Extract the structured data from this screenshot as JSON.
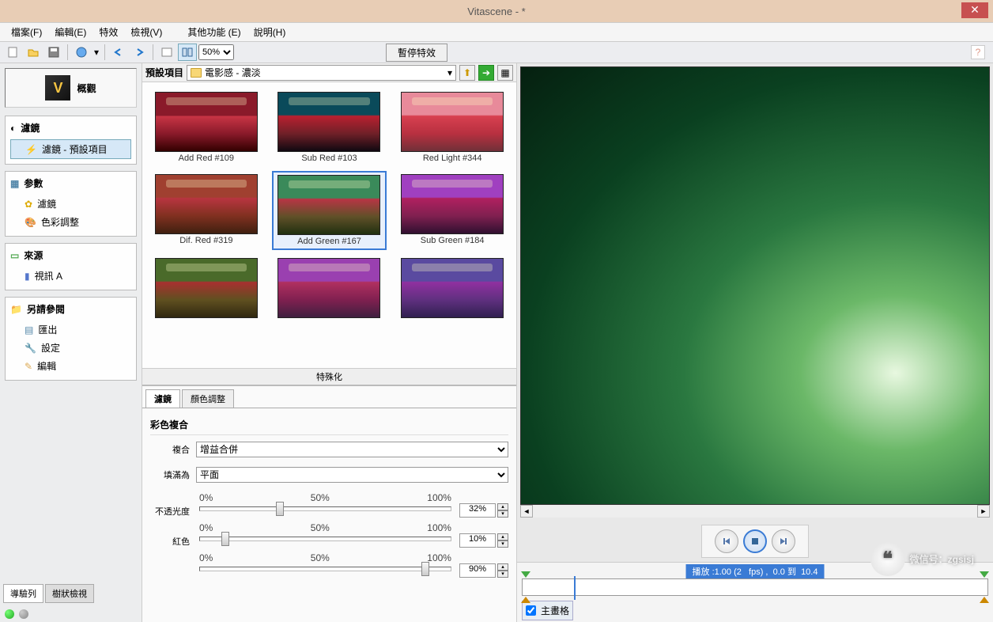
{
  "window": {
    "title": "Vitascene - *",
    "close": "✕"
  },
  "menu": {
    "file": "檔案(F)",
    "edit": "編輯(E)",
    "fx": "特效",
    "view": "檢視(V)",
    "other": "其他功能 (E)",
    "help": "說明(H)"
  },
  "toolbar": {
    "zoom": "50%",
    "pause": "暫停特效"
  },
  "left": {
    "overview": "概觀",
    "filter_h": "濾鏡",
    "filter_item": "濾鏡 - 預設項目",
    "param_h": "参數",
    "param_filter": "濾鏡",
    "param_color": "色彩調整",
    "source_h": "來源",
    "source_item": "視訊 A",
    "see_h": "另請參閱",
    "see_export": "匯出",
    "see_settings": "設定",
    "see_edit": "編輯",
    "tabs": {
      "nav": "導驗列",
      "tree": "樹狀檢視"
    }
  },
  "preset": {
    "label": "預設項目",
    "path": "電影感 - 濃淡",
    "special": "特殊化",
    "items": [
      {
        "name": "Add Red #109"
      },
      {
        "name": "Sub Red #103"
      },
      {
        "name": "Red Light #344"
      },
      {
        "name": "Dif. Red #319"
      },
      {
        "name": "Add Green #167",
        "selected": true
      },
      {
        "name": "Sub Green #184"
      }
    ]
  },
  "params": {
    "tab_filter": "濾鏡",
    "tab_color": "顏色調整",
    "section": "彩色複合",
    "blend_lbl": "複合",
    "blend_val": "增益合併",
    "fill_lbl": "填滿為",
    "fill_val": "平面",
    "opacity_lbl": "不透光度",
    "red_lbl": "紅色",
    "ticks": {
      "t0": "0%",
      "t50": "50%",
      "t100": "100%"
    },
    "opacity_val": "32%",
    "red_val": "10%",
    "extra_val": "90%"
  },
  "preview": {
    "play_info": "播放 :1.00 (2   fps) ,  0.0 到  10.4",
    "main_grid": "主畫格"
  },
  "watermark": "微信号：zgsisj"
}
